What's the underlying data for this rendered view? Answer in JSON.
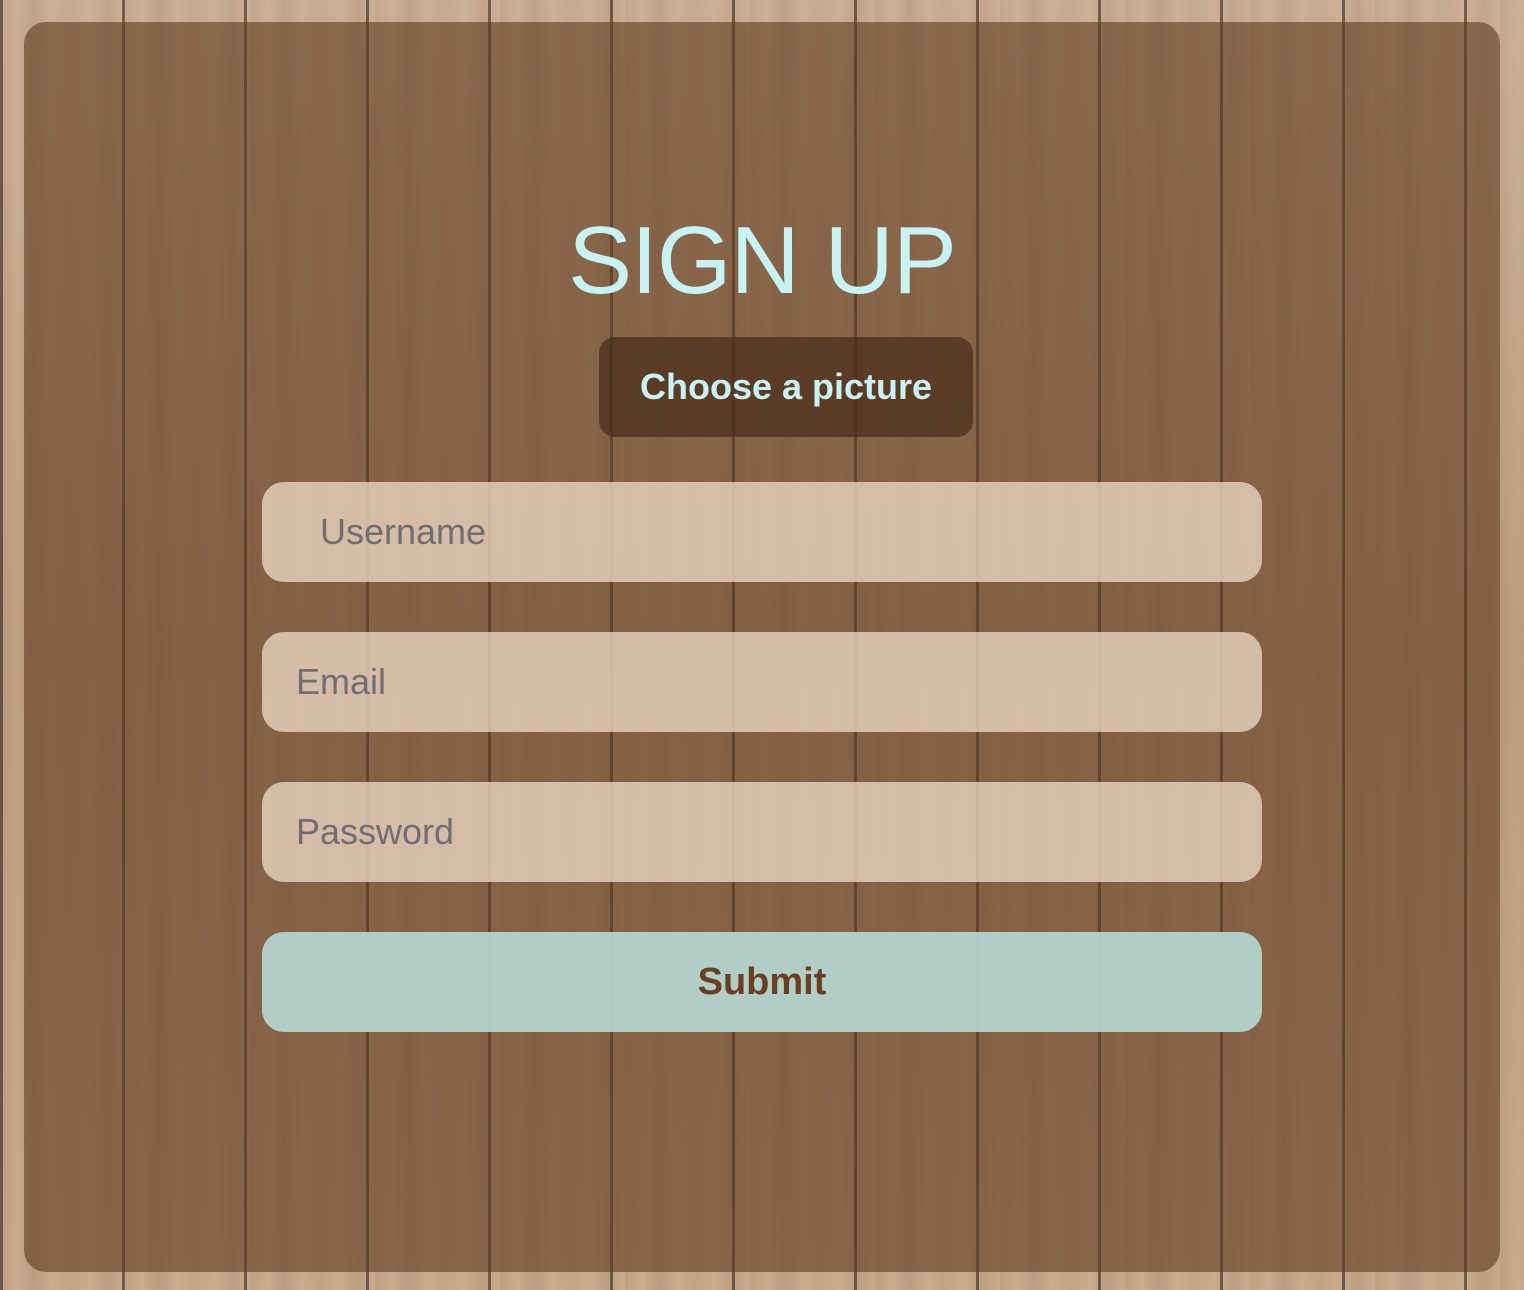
{
  "form": {
    "title": "SIGN UP",
    "choose_picture_label": "Choose a picture",
    "username_placeholder": "Username",
    "email_placeholder": "Email",
    "password_placeholder": "Password",
    "submit_label": "Submit"
  },
  "colors": {
    "title": "#c8f3f4",
    "submit_text": "#6a3f21",
    "submit_background": "#b4d6d0",
    "field_background": "#e8d3bf"
  }
}
